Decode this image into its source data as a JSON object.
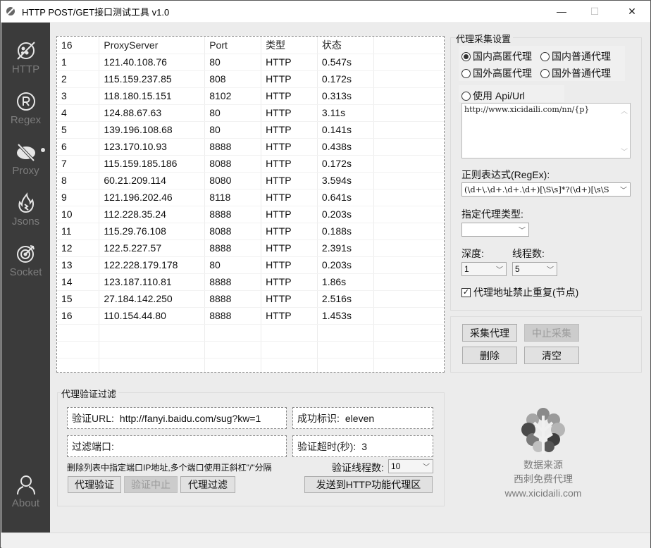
{
  "window": {
    "title": "HTTP POST/GET接口测试工具  v1.0",
    "controls": {
      "minimize": "—",
      "maximize": "☐",
      "close": "✕"
    }
  },
  "sidebar": {
    "items": [
      {
        "label": "HTTP",
        "icon": "planet-icon"
      },
      {
        "label": "Regex",
        "icon": "registered-icon"
      },
      {
        "label": "Proxy",
        "icon": "eye-slash-icon",
        "active": true
      },
      {
        "label": "Jsons",
        "icon": "flame-icon"
      },
      {
        "label": "Socket",
        "icon": "target-icon"
      }
    ],
    "about": {
      "label": "About",
      "icon": "user-icon"
    }
  },
  "proxy_table": {
    "headers": [
      "16",
      "ProxyServer",
      "Port",
      "类型",
      "状态",
      ""
    ],
    "rows": [
      [
        "1",
        "121.40.108.76",
        "80",
        "HTTP",
        "0.547s"
      ],
      [
        "2",
        "115.159.237.85",
        "808",
        "HTTP",
        "0.172s"
      ],
      [
        "3",
        "118.180.15.151",
        "8102",
        "HTTP",
        "0.313s"
      ],
      [
        "4",
        "124.88.67.63",
        "80",
        "HTTP",
        "3.11s"
      ],
      [
        "5",
        "139.196.108.68",
        "80",
        "HTTP",
        "0.141s"
      ],
      [
        "6",
        "123.170.10.93",
        "8888",
        "HTTP",
        "0.438s"
      ],
      [
        "7",
        "115.159.185.186",
        "8088",
        "HTTP",
        "0.172s"
      ],
      [
        "8",
        "60.21.209.114",
        "8080",
        "HTTP",
        "3.594s"
      ],
      [
        "9",
        "121.196.202.46",
        "8118",
        "HTTP",
        "0.641s"
      ],
      [
        "10",
        "112.228.35.24",
        "8888",
        "HTTP",
        "0.203s"
      ],
      [
        "11",
        "115.29.76.108",
        "8088",
        "HTTP",
        "0.188s"
      ],
      [
        "12",
        "122.5.227.57",
        "8888",
        "HTTP",
        "2.391s"
      ],
      [
        "13",
        "122.228.179.178",
        "80",
        "HTTP",
        "0.203s"
      ],
      [
        "14",
        "123.187.110.81",
        "8888",
        "HTTP",
        "1.86s"
      ],
      [
        "15",
        "27.184.142.250",
        "8888",
        "HTTP",
        "2.516s"
      ],
      [
        "16",
        "110.154.44.80",
        "8888",
        "HTTP",
        "1.453s"
      ]
    ]
  },
  "collect_settings": {
    "title": "代理采集设置",
    "radios": [
      {
        "label": "国内高匿代理",
        "checked": true
      },
      {
        "label": "国内普通代理",
        "checked": false
      },
      {
        "label": "国外高匿代理",
        "checked": false
      },
      {
        "label": "国外普通代理",
        "checked": false
      }
    ],
    "api_radio": {
      "label": "使用 Api/Url",
      "checked": false
    },
    "api_url": "http://www.xicidaili.com/nn/{p}",
    "regex_label": "正则表达式(RegEx):",
    "regex_value": "(\\d+\\.\\d+.\\d+.\\d+)[\\S\\s]*?(\\d+)[\\s\\S",
    "proxy_type_label": "指定代理类型:",
    "proxy_type_value": "",
    "depth_label": "深度:",
    "depth_value": "1",
    "threads_label": "线程数:",
    "threads_value": "5",
    "no_duplicate": {
      "label": "代理地址禁止重复(节点)",
      "checked": true
    }
  },
  "collect_actions": {
    "collect": "采集代理",
    "stop": "中止采集",
    "delete": "删除",
    "clear": "清空"
  },
  "verify": {
    "title": "代理验证过滤",
    "url_label": "验证URL:",
    "url_value": "http://fanyi.baidu.com/sug?kw=1",
    "success_label": "成功标识:",
    "success_value": "eleven",
    "port_filter_label": "过滤端口:",
    "port_filter_value": "",
    "timeout_label": "验证超时(秒):",
    "timeout_value": "3",
    "hint": "删除列表中指定端口IP地址,多个端口使用正斜杠\"/\"分隔",
    "threads_label": "验证线程数:",
    "threads_value": "10",
    "btn_verify": "代理验证",
    "btn_stop": "验证中止",
    "btn_filter": "代理过滤",
    "btn_send": "发送到HTTP功能代理区"
  },
  "brand": {
    "line1": "数据来源",
    "line2": "西刺免费代理",
    "line3": "www.xicidaili.com"
  }
}
